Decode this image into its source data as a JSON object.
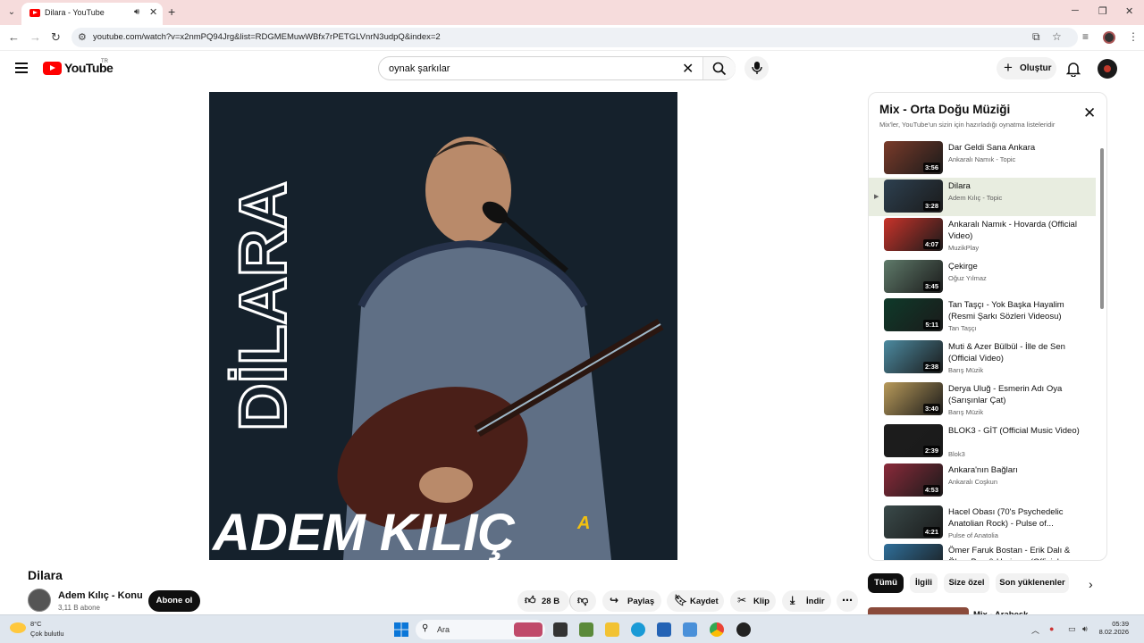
{
  "browser": {
    "tab_title": "Dilara - YouTube",
    "url": "youtube.com/watch?v=x2nmPQ94Jrg&list=RDGMEMuwWBfx7rPETGLVnrN3udpQ&index=2"
  },
  "header": {
    "logo_text": "YouTube",
    "country_code": "TR",
    "search_value": "oynak şarkılar",
    "create_label": "Oluştur"
  },
  "artwork": {
    "vertical_text": "DİLARA",
    "artist_text": "ADEM KILIÇ",
    "logo_text": "A"
  },
  "video": {
    "title": "Dilara",
    "channel_name": "Adem Kılıç - Konu",
    "subscribers": "3,11 B abone",
    "subscribe_label": "Abone ol",
    "like_count": "28 B",
    "share_label": "Paylaş",
    "save_label": "Kaydet",
    "clip_label": "Klip",
    "download_label": "İndir"
  },
  "playlist": {
    "title": "Mix - Orta Doğu Müziği",
    "subtitle": "Mix'ler, YouTube'un sizin için hazırladığı oynatma listeleridir",
    "items": [
      {
        "title": "Dar Geldi Sana Ankara",
        "channel": "Ankaralı Namık - Topic",
        "duration": "3:56",
        "color": "#7a3b2a"
      },
      {
        "title": "Dilara",
        "channel": "Adem Kılıç - Topic",
        "duration": "3:28",
        "color": "#2d4050"
      },
      {
        "title": "Ankaralı Namık - Hovarda (Official Video)",
        "channel": "MuzikPlay",
        "duration": "4:07",
        "color": "#c8332a"
      },
      {
        "title": "Çekirge",
        "channel": "Oğuz Yılmaz",
        "duration": "3:45",
        "color": "#5f7a6a"
      },
      {
        "title": "Tan Taşçı - Yok Başka Hayalim (Resmi Şarkı Sözleri Videosu)",
        "channel": "Tan Taşçı",
        "duration": "5:11",
        "color": "#0f3a2a"
      },
      {
        "title": "Muti & Azer Bülbül - İlle de Sen (Official Video)",
        "channel": "Barış Müzik",
        "duration": "2:38",
        "color": "#4c8aa0"
      },
      {
        "title": "Derya Uluğ - Esmerin Adı Oya (Sarışınlar Çat)",
        "channel": "Barış Müzik",
        "duration": "3:40",
        "color": "#b89a5a"
      },
      {
        "title": "BLOK3 - GİT (Official Music Video)",
        "channel": "Blok3",
        "duration": "2:39",
        "color": "#1d1d1d"
      },
      {
        "title": "Ankara'nın Bağları",
        "channel": "Ankaralı Coşkun",
        "duration": "4:53",
        "color": "#8a2a3a"
      },
      {
        "title": "Hacel Obası (70's Psychedelic Anatolian Rock) - Pulse of...",
        "channel": "Pulse of Anatolia",
        "duration": "4:21",
        "color": "#3a4a4a"
      },
      {
        "title": "Ömer Faruk Bostan - Erik Dalı & Ölem Ben & Hurişem (Official",
        "channel": "",
        "duration": "",
        "color": "#2f6f9a"
      }
    ]
  },
  "chips": [
    "Tümü",
    "İlgili",
    "Size özel",
    "Son yüklenenler"
  ],
  "partial_next": "Mix - Arabesk",
  "taskbar": {
    "temp": "8°C",
    "weather": "Çok bulutlu",
    "search_label": "Ara",
    "time": "05:39",
    "date": "8.02.2026"
  }
}
